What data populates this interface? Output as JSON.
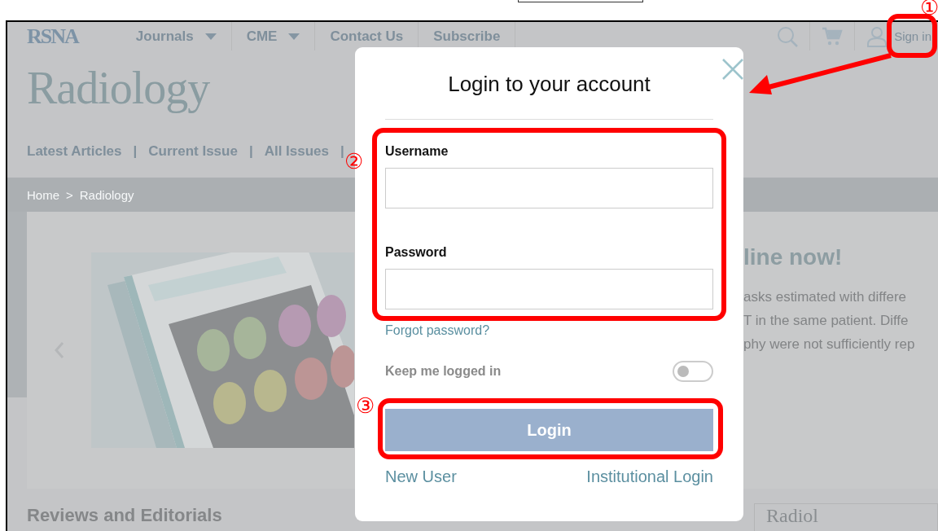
{
  "nav": {
    "logo": "RSNA",
    "items": [
      {
        "label": "Journals",
        "dropdown": true
      },
      {
        "label": "CME",
        "dropdown": true
      },
      {
        "label": "Contact Us",
        "dropdown": false
      },
      {
        "label": "Subscribe",
        "dropdown": false
      }
    ],
    "sign_in": "Sign in"
  },
  "journal": {
    "title": "Radiology",
    "links": [
      "Latest Articles",
      "Current Issue",
      "All Issues"
    ],
    "link_separator": "|"
  },
  "breadcrumb": {
    "items": [
      "Home",
      "Radiology"
    ],
    "separator": ">"
  },
  "hero": {
    "heading": "line now!",
    "text_lines": [
      "asks estimated with differe",
      "T in the same patient. Diffe",
      "phy were not sufficiently rep"
    ]
  },
  "section_heading": "Reviews and Editorials",
  "side_card": {
    "title": "Radiol"
  },
  "modal": {
    "title": "Login to your account",
    "fields": [
      {
        "label": "Username"
      },
      {
        "label": "Password"
      }
    ],
    "forgot": "Forgot password?",
    "keep_logged_in": {
      "label": "Keep me logged in",
      "on": false
    },
    "login_button": "Login",
    "links": [
      "New User",
      "Institutional Login"
    ]
  },
  "annotations": {
    "markers": [
      "①",
      "②",
      "③"
    ]
  }
}
